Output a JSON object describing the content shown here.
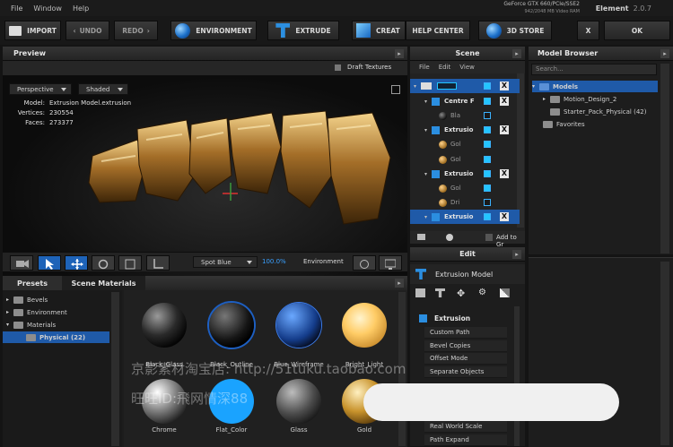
{
  "menu": {
    "items": [
      "File",
      "Window",
      "Help"
    ]
  },
  "gpu": {
    "line1": "GeForce GTX 660/PCIe/SSE2",
    "line2": "942/2048 MB Video RAM"
  },
  "app": {
    "name": "Element",
    "version": "2.0.7"
  },
  "toolbar": {
    "import": "IMPORT",
    "undo": "UNDO",
    "redo": "REDO",
    "environment": "ENVIRONMENT",
    "extrude": "EXTRUDE",
    "create": "CREAT",
    "help_center": "HELP CENTER",
    "store": "3D STORE",
    "close": "X",
    "ok": "OK"
  },
  "preview": {
    "title": "Preview",
    "draft_textures": "Draft Textures",
    "perspective": "Perspective",
    "shaded": "Shaded",
    "info": [
      {
        "key": "Model:",
        "value": "Extrusion Model.extrusion"
      },
      {
        "key": "Vertices:",
        "value": "230554"
      },
      {
        "key": "Faces:",
        "value": "273377"
      }
    ],
    "light": "Spot Blue",
    "zoom": "100.0%",
    "environment": "Environment"
  },
  "scene": {
    "title": "Scene",
    "menu": [
      "File",
      "Edit",
      "View"
    ],
    "rows": [
      {
        "label": "",
        "level": 0
      },
      {
        "label": "Centre F",
        "level": 1
      },
      {
        "label": "Bla",
        "level": 2
      },
      {
        "label": "Extrusio",
        "level": 1
      },
      {
        "label": "Gol",
        "level": 2
      },
      {
        "label": "Gol",
        "level": 2
      },
      {
        "label": "Extrusio",
        "level": 1
      },
      {
        "label": "Gol",
        "level": 2
      },
      {
        "label": "Dri",
        "level": 2
      },
      {
        "label": "Extrusio",
        "level": 1
      }
    ],
    "add_to_group": "Add to Gr"
  },
  "edit": {
    "title": "Edit",
    "subtitle": "Extrusion Model",
    "section": "Extrusion",
    "rows": [
      "Custom Path",
      "Bevel Copies",
      "Offset Mode",
      "Separate Objects",
      "Real World Scale",
      "Path Expand"
    ]
  },
  "model_browser": {
    "title": "Model Browser",
    "search_placeholder": "Search...",
    "tree": [
      {
        "label": "Models",
        "level": 0
      },
      {
        "label": "Motion_Design_2",
        "level": 1
      },
      {
        "label": "Starter_Pack_Physical (42)",
        "level": 1
      },
      {
        "label": "Favorites",
        "level": 0
      }
    ]
  },
  "presets": {
    "tab1": "Presets",
    "tab2": "Scene Materials",
    "tree": [
      {
        "label": "Bevels"
      },
      {
        "label": "Environment"
      },
      {
        "label": "Materials"
      },
      {
        "label": "Physical (22)"
      }
    ],
    "materials": [
      "Black_Glass",
      "Black_Outline",
      "Blue_Wireframe",
      "Bright_Light",
      "Chrome",
      "Flat_Color",
      "Glass",
      "Gold"
    ]
  },
  "watermark": {
    "line1": "京影素材淘宝店: http://51tuku.taobao.com",
    "line2": "旺旺ID:飛网情深88"
  },
  "colors": {
    "accent": "#1f5aa8",
    "toggle": "#23c5ff",
    "bg": "#1d1d1d"
  }
}
